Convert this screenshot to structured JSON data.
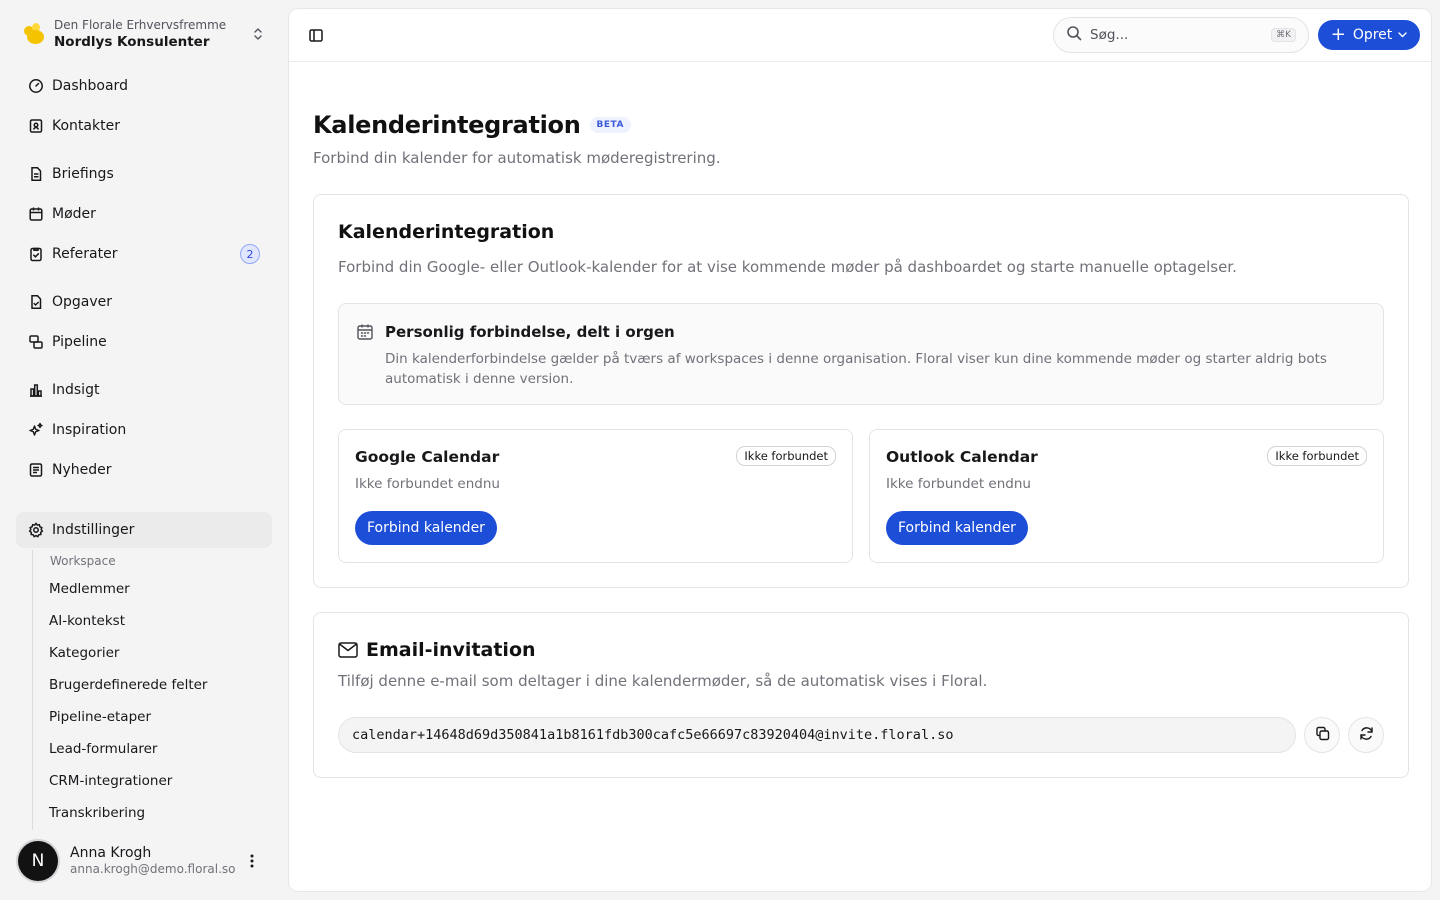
{
  "workspace": {
    "org": "Den Florale Erhvervsfremme",
    "name": "Nordlys Konsulenter"
  },
  "nav": {
    "dashboard": "Dashboard",
    "kontakter": "Kontakter",
    "briefings": "Briefings",
    "moder": "Møder",
    "referater": "Referater",
    "referater_count": "2",
    "opgaver": "Opgaver",
    "pipeline": "Pipeline",
    "indsigt": "Indsigt",
    "inspiration": "Inspiration",
    "nyheder": "Nyheder",
    "indstillinger": "Indstillinger"
  },
  "settings_sub": {
    "heading": "Workspace",
    "items": [
      "Medlemmer",
      "AI-kontekst",
      "Kategorier",
      "Brugerdefinerede felter",
      "Pipeline-etaper",
      "Lead-formularer",
      "CRM-integrationer",
      "Transkribering"
    ]
  },
  "user": {
    "initial": "N",
    "name": "Anna Krogh",
    "email": "anna.krogh@demo.floral.so"
  },
  "topbar": {
    "search_placeholder": "Søg...",
    "search_shortcut": "⌘K",
    "create_label": "Opret"
  },
  "page": {
    "title": "Kalenderintegration",
    "badge": "BETA",
    "subtitle": "Forbind din kalender for automatisk møderegistrering."
  },
  "integration_card": {
    "title": "Kalenderintegration",
    "subtitle": "Forbind din Google- eller Outlook-kalender for at vise kommende møder på dashboardet og starte manuelle optagelser.",
    "notice_title": "Personlig forbindelse, delt i orgen",
    "notice_body": "Din kalenderforbindelse gælder på tværs af workspaces i denne organisation. Floral viser kun dine kommende møder og starter aldrig bots automatisk i denne version.",
    "providers": [
      {
        "name": "Google Calendar",
        "badge": "Ikke forbundet",
        "status": "Ikke forbundet endnu",
        "button": "Forbind kalender"
      },
      {
        "name": "Outlook Calendar",
        "badge": "Ikke forbundet",
        "status": "Ikke forbundet endnu",
        "button": "Forbind kalender"
      }
    ]
  },
  "email_card": {
    "title": "Email-invitation",
    "subtitle": "Tilføj denne e-mail som deltager i dine kalendermøder, så de automatisk vises i Floral.",
    "address": "calendar+14648d69d350841a1b8161fdb300cafc5e66697c83920404@invite.floral.so"
  },
  "colors": {
    "primary": "#1d4ed8",
    "background": "#f4f4f5",
    "muted_text": "#71717a"
  }
}
